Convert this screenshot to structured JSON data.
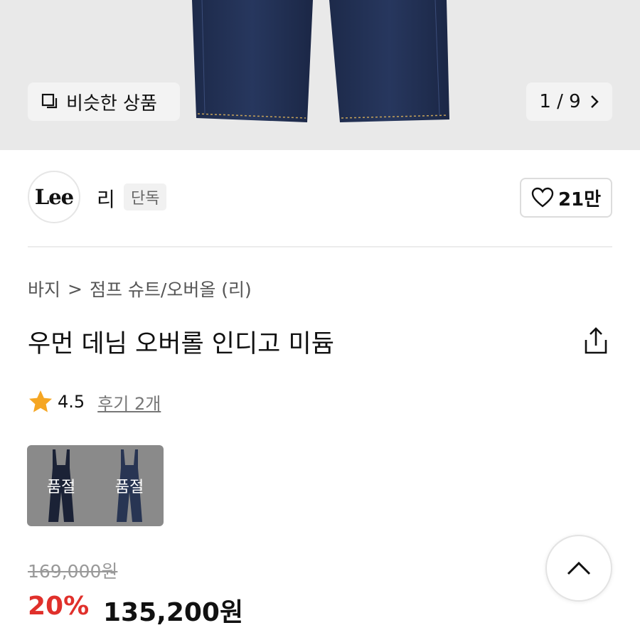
{
  "hero": {
    "similar_label": "비슷한 상품",
    "pager_text": "1 / 9"
  },
  "brand": {
    "logo_text": "Lee",
    "name": "리",
    "badge": "단독",
    "like_count": "21만"
  },
  "product": {
    "breadcrumb": [
      "바지",
      ">",
      "점프 슈트/오버올 (리)"
    ],
    "title": "우먼 데님 오버롤 인디고 미듐",
    "rating": "4.5",
    "reviews_label": "후기 2개",
    "variants": [
      {
        "label": "품절"
      },
      {
        "label": "품절"
      }
    ],
    "original_price": "169,000원",
    "discount": "20%",
    "sale_price": "135,200원"
  },
  "colors": {
    "accent_red": "#e0302b",
    "star": "#f5a623"
  },
  "icons": [
    "copy-icon",
    "chevron-right-icon",
    "heart-icon",
    "share-icon",
    "star-icon",
    "chevron-up-icon"
  ]
}
